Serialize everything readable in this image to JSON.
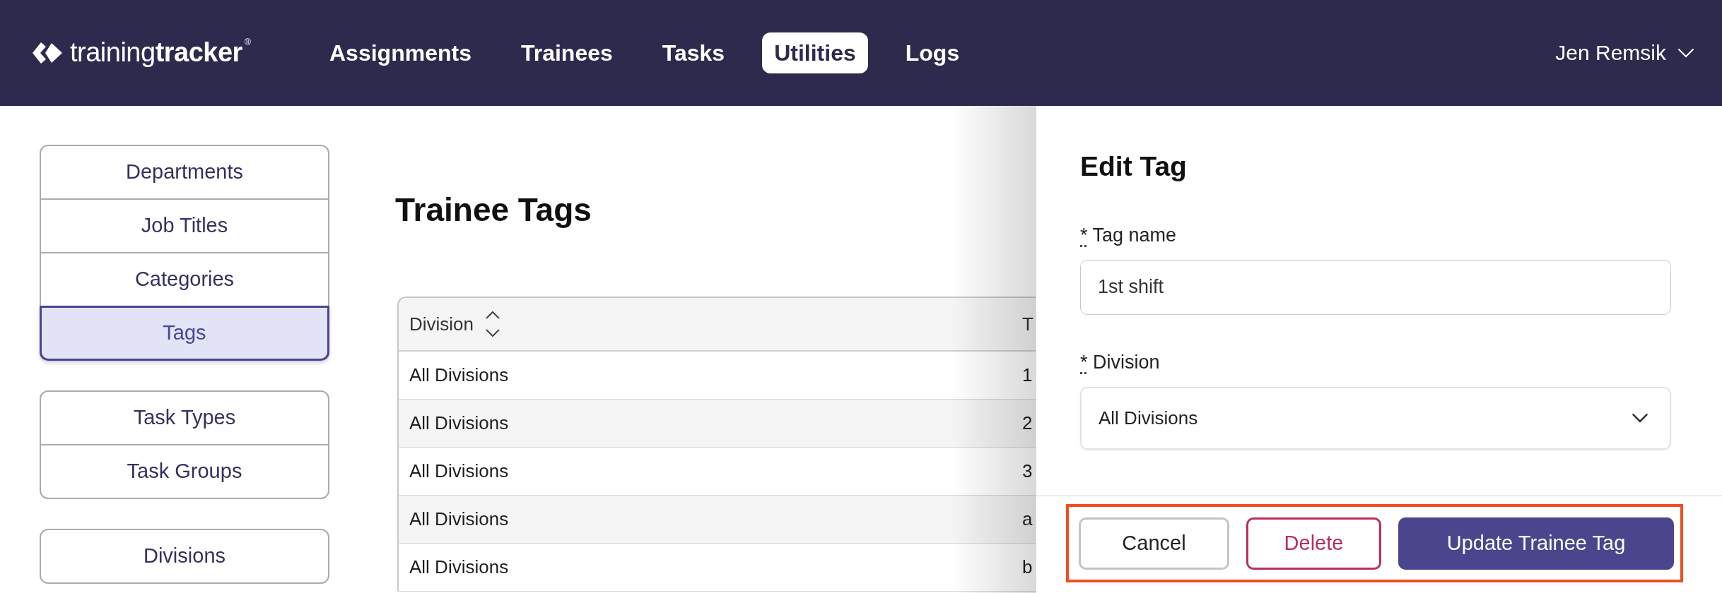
{
  "nav": {
    "logo": "training**tracker**$^{®}$",
    "items": [
      {
        "label": "Assignments",
        "selected": false
      },
      {
        "label": "Trainees",
        "selected": false
      },
      {
        "label": "Tasks",
        "selected": false
      },
      {
        "label": "Utilities",
        "selected": true
      },
      {
        "label": "Logs",
        "selected": false
      }
    ],
    "user": {
      "name": "Jen Remsik"
    }
  },
  "sidebar": {
    "groups": [
      {
        "items": [
          {
            "label": "Departments",
            "selected": false
          },
          {
            "label": "Job Titles",
            "selected": false
          },
          {
            "label": "Categories",
            "selected": false
          },
          {
            "label": "Tags",
            "selected": true
          }
        ]
      },
      {
        "items": [
          {
            "label": "Task Types",
            "selected": false
          },
          {
            "label": "Task Groups",
            "selected": false
          }
        ]
      },
      {
        "items": [
          {
            "label": "Divisions",
            "selected": false
          }
        ]
      }
    ]
  },
  "page": {
    "title": "Trainee Tags"
  },
  "table": {
    "columns": [
      {
        "label": "Division",
        "sortable": true
      },
      {
        "label": "T"
      }
    ],
    "rows": [
      [
        "All Divisions",
        "1"
      ],
      [
        "All Divisions",
        "2"
      ],
      [
        "All Divisions",
        "3"
      ],
      [
        "All Divisions",
        "a"
      ],
      [
        "All Divisions",
        "b"
      ]
    ]
  },
  "edit_panel": {
    "title": "Edit Tag",
    "fields": [
      {
        "kind": "text",
        "label": "Tag name",
        "required_mark": "*",
        "value": "1st shift"
      },
      {
        "kind": "select",
        "label": "Division",
        "required_mark": "*",
        "value": "All Divisions"
      }
    ],
    "footer": {
      "highlighted": true,
      "buttons": [
        {
          "kind": "secondary",
          "label": "Cancel"
        },
        {
          "kind": "danger",
          "label": "Delete"
        },
        {
          "kind": "primary",
          "label": "Update Trainee Tag"
        }
      ]
    }
  }
}
